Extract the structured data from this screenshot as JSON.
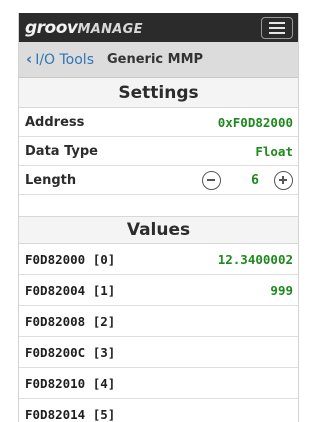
{
  "header": {
    "logo_brand": "groov",
    "logo_product": "MANAGE",
    "menu_icon": "hamburger-icon"
  },
  "breadcrumb": {
    "back_icon": "chevron-left-icon",
    "parent_label": "I/O Tools",
    "current_label": "Generic MMP"
  },
  "settings": {
    "title": "Settings",
    "address": {
      "label": "Address",
      "value": "0xF0D82000"
    },
    "data_type": {
      "label": "Data Type",
      "value": "Float"
    },
    "length": {
      "label": "Length",
      "value": "6",
      "decrement_icon": "minus-circle-icon",
      "increment_icon": "plus-circle-icon"
    }
  },
  "values": {
    "title": "Values",
    "rows": [
      {
        "address": "F0D82000 [0]",
        "value": "12.3400002"
      },
      {
        "address": "F0D82004 [1]",
        "value": "999"
      },
      {
        "address": "F0D82008 [2]",
        "value": ""
      },
      {
        "address": "F0D8200C [3]",
        "value": ""
      },
      {
        "address": "F0D82010 [4]",
        "value": ""
      },
      {
        "address": "F0D82014 [5]",
        "value": ""
      }
    ]
  },
  "colors": {
    "topbar_bg": "#2b2b2b",
    "link": "#2f76b5",
    "value_green": "#1d8a1d"
  }
}
